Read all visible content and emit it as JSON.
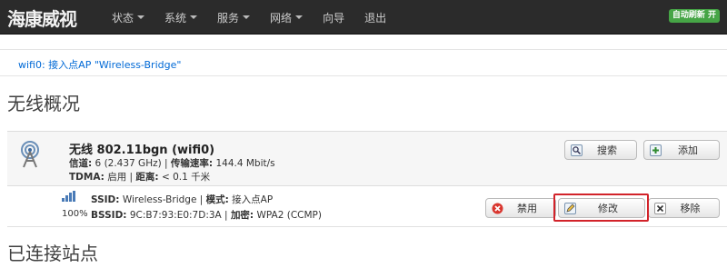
{
  "header": {
    "brand": "海康威视",
    "menu": [
      {
        "label": "状态",
        "dropdown": true
      },
      {
        "label": "系统",
        "dropdown": true
      },
      {
        "label": "服务",
        "dropdown": true
      },
      {
        "label": "网络",
        "dropdown": true
      },
      {
        "label": "向导",
        "dropdown": false
      },
      {
        "label": "退出",
        "dropdown": false
      }
    ],
    "auto_refresh": "自动刷新 开",
    "colors": {
      "bar": "#2b2b2b",
      "refresh_badge": "#46a546"
    }
  },
  "breadcrumb": {
    "link": "wifi0: 接入点AP \"Wireless-Bridge\""
  },
  "overview": {
    "title": "无线概况",
    "radio": {
      "name": "无线 802.11bgn (wifi0)",
      "channel_label": "信道:",
      "channel_value": "6 (2.437 GHz)",
      "rate_label": "传输速率:",
      "rate_value": "144.4 Mbit/s",
      "tdma_label": "TDMA:",
      "tdma_value": "启用",
      "distance_label": "距离:",
      "distance_value": "< 0.1 千米",
      "buttons": {
        "search": "搜索",
        "add": "添加"
      }
    },
    "network": {
      "signal_percent": "100%",
      "ssid_label": "SSID:",
      "ssid_value": "Wireless-Bridge",
      "mode_label": "模式:",
      "mode_value": "接入点AP",
      "bssid_label": "BSSID:",
      "bssid_value": "9C:B7:93:E0:7D:3A",
      "encryption_label": "加密:",
      "encryption_value": "WPA2 (CCMP)",
      "buttons": {
        "disable": "禁用",
        "edit": "修改",
        "remove": "移除"
      },
      "highlight_color": "#d2232a"
    }
  },
  "stations": {
    "title": "已连接站点"
  }
}
